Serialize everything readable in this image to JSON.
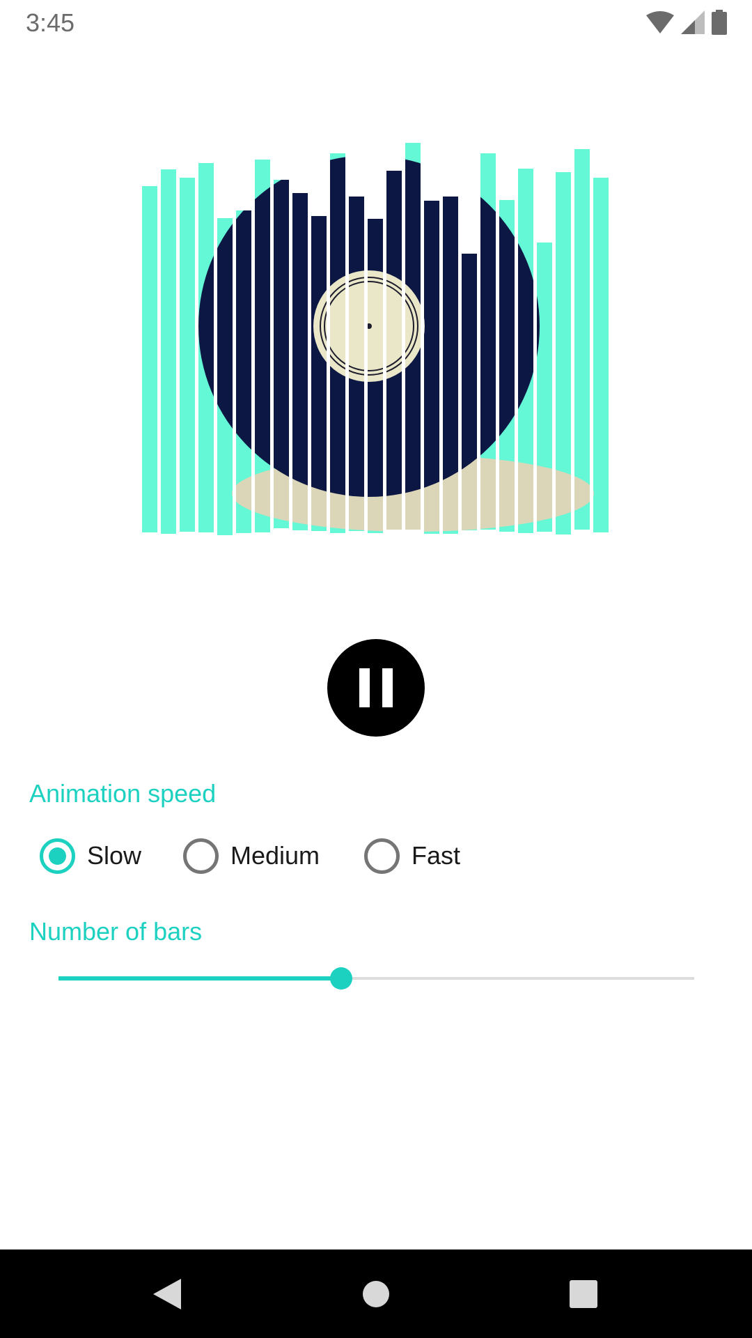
{
  "status_bar": {
    "time": "3:45",
    "icons": [
      "wifi-icon",
      "cell-signal-icon",
      "battery-icon"
    ],
    "icon_color": "#6b6b6b"
  },
  "visualizer": {
    "artwork": "vinyl-record-with-hand",
    "bar_color": "#64f8d6",
    "record_color": "#0d1744",
    "label_color": "#eae6c8",
    "hand_color": "#dcd6b8",
    "bar_count": 25
  },
  "player": {
    "state": "playing",
    "control_icon": "pause-icon"
  },
  "animation_speed": {
    "label": "Animation speed",
    "options": [
      "Slow",
      "Medium",
      "Fast"
    ],
    "selected": "Slow"
  },
  "number_of_bars": {
    "label": "Number of bars",
    "value_fraction": 0.445
  },
  "nav_bar": {
    "icons": [
      "back-icon",
      "home-icon",
      "recents-icon"
    ]
  },
  "colors": {
    "accent": "#1dd1c1",
    "radio_off": "#757575",
    "track": "#dcdcdc"
  }
}
